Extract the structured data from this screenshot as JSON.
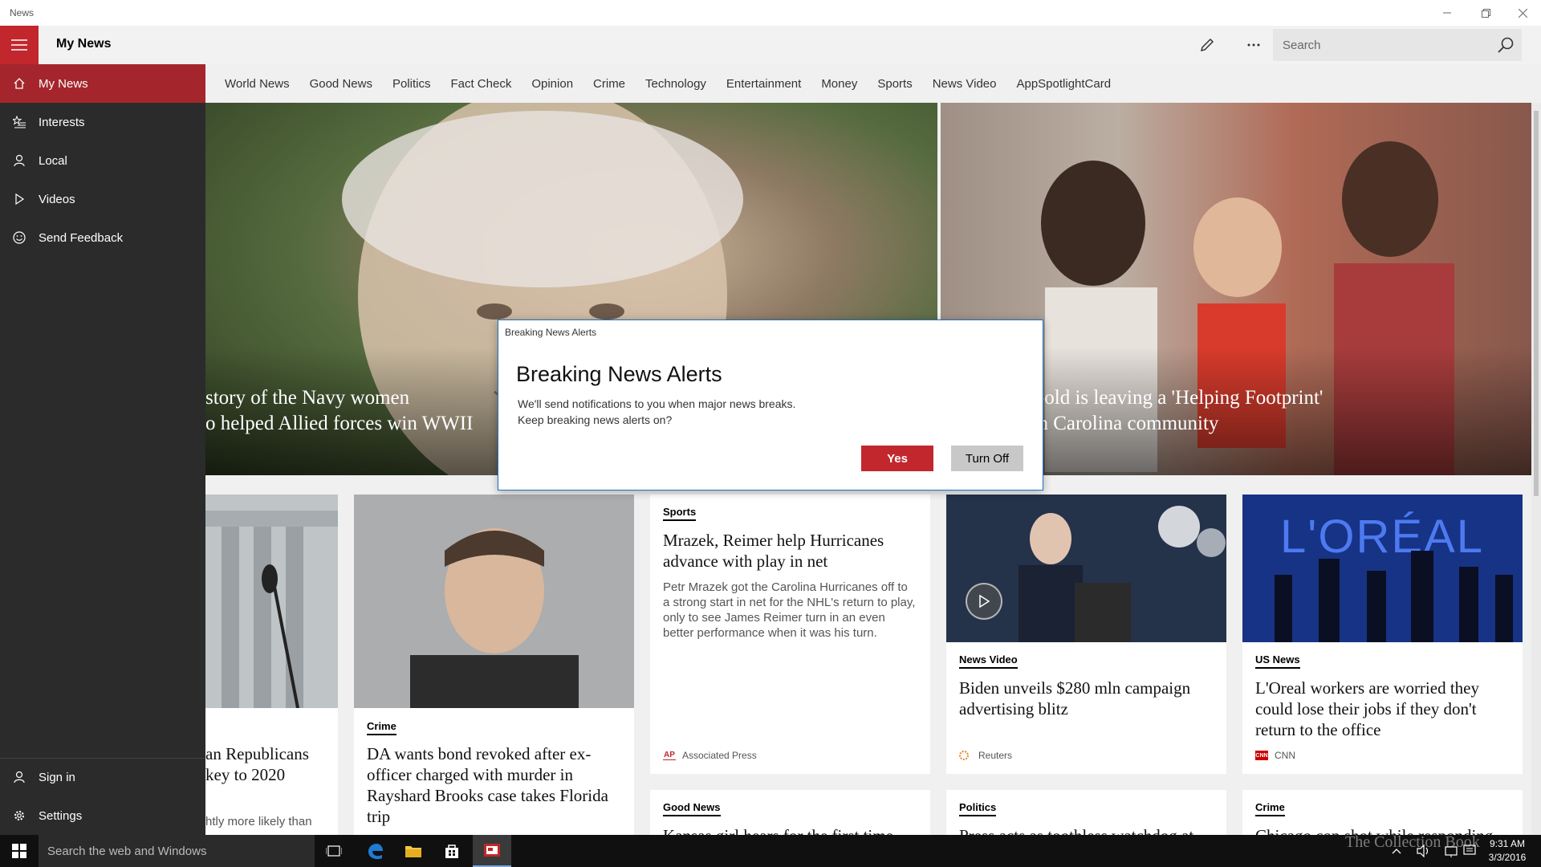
{
  "window": {
    "title": "News"
  },
  "header": {
    "title": "My News",
    "search_placeholder": "Search"
  },
  "sidebar": {
    "items": [
      {
        "label": "My News",
        "icon": "home-icon"
      },
      {
        "label": "Interests",
        "icon": "star-list-icon"
      },
      {
        "label": "Local",
        "icon": "person-location-icon"
      },
      {
        "label": "Videos",
        "icon": "play-icon"
      },
      {
        "label": "Send Feedback",
        "icon": "smiley-icon"
      }
    ],
    "bottom_items": [
      {
        "label": "Sign in",
        "icon": "person-icon"
      },
      {
        "label": "Settings",
        "icon": "gear-icon"
      }
    ]
  },
  "tabs": [
    "World News",
    "Good News",
    "Politics",
    "Fact Check",
    "Opinion",
    "Crime",
    "Technology",
    "Entertainment",
    "Money",
    "Sports",
    "News Video",
    "AppSpotlightCard"
  ],
  "hero": [
    {
      "line1": "story of the Navy women",
      "line2": "o helped Allied forces win WWII"
    },
    {
      "line1": "ar-old is leaving a 'Helping Footprint'",
      "line2": "uth Carolina community"
    }
  ],
  "cards": {
    "c1": {
      "title_line1": "an Republicans",
      "title_line2": "key to 2020",
      "snippet": "htly more likely than"
    },
    "c2": {
      "category": "Crime",
      "title": "DA wants bond revoked after ex-officer charged with murder in Rayshard Brooks case takes Florida trip"
    },
    "c3": {
      "category": "Sports",
      "title": "Mrazek, Reimer help Hurricanes advance with play in net",
      "snippet": "Petr Mrazek got the Carolina Hurricanes off to a strong start in net for the NHL's return to play, only to see James Reimer turn in an even better performance when it was his turn.",
      "source": "Associated Press",
      "source_logo": "AP"
    },
    "c4": {
      "category": "News Video",
      "title": "Biden unveils $280 mln campaign advertising blitz",
      "source": "Reuters",
      "source_logo": "reuters-logo-icon"
    },
    "c5": {
      "category": "US News",
      "title": "L'Oreal workers are worried they could lose their jobs if they don't return to the office",
      "source": "CNN",
      "source_logo": "CNN",
      "image_text": "L'ORÉAL"
    },
    "c6": {
      "category": "Good News",
      "title": "Kansas girl hears for the first time"
    },
    "c7": {
      "category": "Politics",
      "title": "Press acts as toothless watchdog at"
    },
    "c8": {
      "category": "Crime",
      "title": "Chicago cop shot while responding"
    }
  },
  "dialog": {
    "caption": "Breaking News Alerts",
    "title": "Breaking News Alerts",
    "body_line1": "We'll send notifications to you when major news breaks.",
    "body_line2": "Keep breaking news alerts on?",
    "yes_label": "Yes",
    "off_label": "Turn Off"
  },
  "taskbar": {
    "search_placeholder": "Search the web and Windows",
    "time": "9:31 AM",
    "date": "3/3/2016"
  },
  "watermark": "The Collection Book",
  "colors": {
    "accent": "#c1272d",
    "sidebar_bg": "#2b2b2b",
    "active_nav": "#a4262c",
    "dialog_border": "#1e70c1"
  }
}
